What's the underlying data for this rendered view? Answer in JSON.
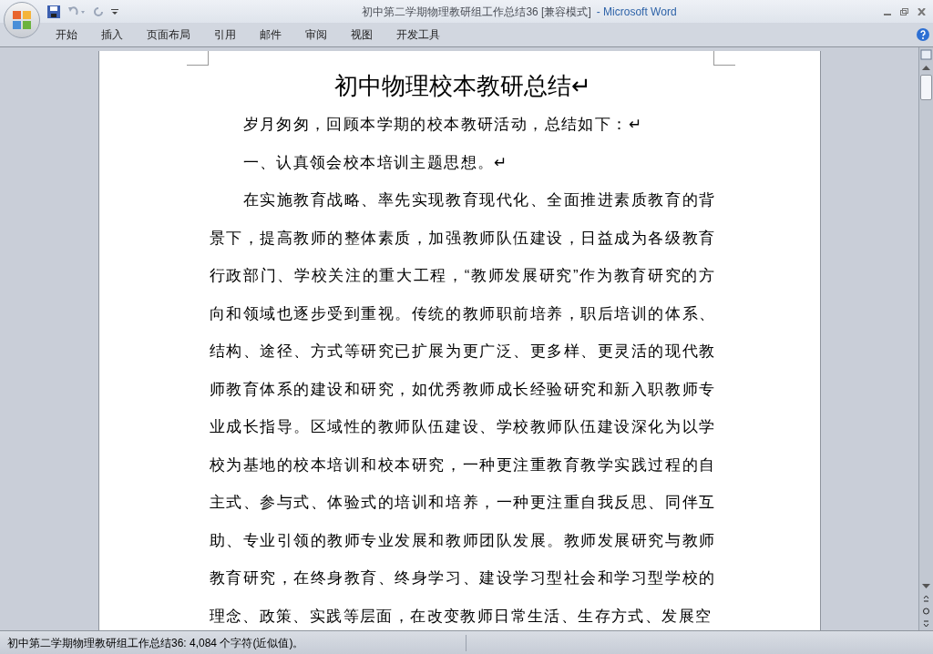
{
  "window": {
    "title": "初中第二学期物理教研组工作总结36 [兼容模式]",
    "app": "- Microsoft Word"
  },
  "ribbon_tabs": [
    {
      "label": "开始",
      "selected": false
    },
    {
      "label": "插入",
      "selected": false
    },
    {
      "label": "页面布局",
      "selected": false
    },
    {
      "label": "引用",
      "selected": false
    },
    {
      "label": "邮件",
      "selected": false
    },
    {
      "label": "审阅",
      "selected": false
    },
    {
      "label": "视图",
      "selected": false
    },
    {
      "label": "开发工具",
      "selected": false
    }
  ],
  "document": {
    "title": "初中物理校本教研总结↵",
    "paragraphs": [
      {
        "text": "岁月匆匆，回顾本学期的校本教研活动，总结如下：↵"
      },
      {
        "text": "一、认真领会校本培训主题思想。↵"
      },
      {
        "text": "在实施教育战略、率先实现教育现代化、全面推进素质教育的背景下，提高教师的整体素质，加强教师队伍建设，日益成为各级教育行政部门、学校关注的重大工程，“教师发展研究”作为教育研究的方向和领域也逐步受到重视。传统的教师职前培养，职后培训的体系、结构、途径、方式等研究已扩展为更广泛、更多样、更灵活的现代教师教育体系的建设和研究，如优秀教师成长经验研究和新入职教师专业成长指导。区域性的教师队伍建设、学校教师队伍建设深化为以学校为基地的校本培训和校本研究，一种更注重教育教学实践过程的自主式、参与式、体验式的培训和培养，一种更注重自我反思、同伴互助、专业引领的教师专业发展和教师团队发展。教师发展研究与教师教育研究，在终身教育、终身学习、建设学习型社会和学习型学校的理念、政策、实践等层面，在改变教师日常生活、生存方式、发展空"
      }
    ]
  },
  "status_bar": {
    "text": "初中第二学期物理教研组工作总结36: 4,084 个字符(近似值)。"
  }
}
